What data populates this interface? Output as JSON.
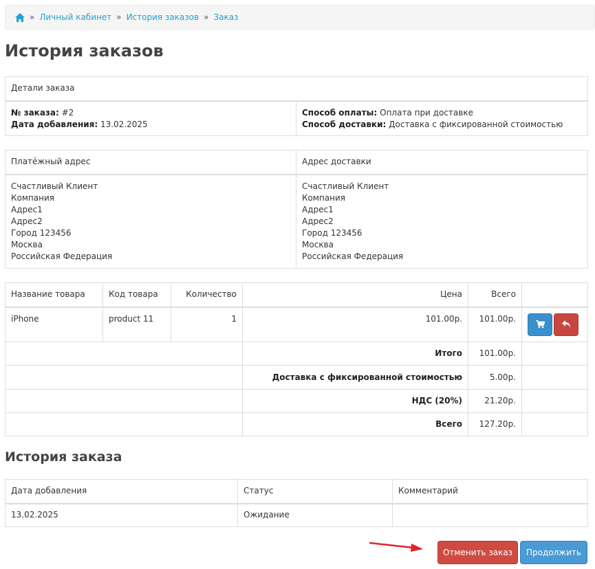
{
  "breadcrumb": {
    "home_icon": "home-icon",
    "items": [
      "Личный кабинет",
      "История заказов",
      "Заказ"
    ],
    "separator": "»"
  },
  "page_title": "История заказов",
  "order_details": {
    "header": "Детали заказа",
    "order_no_label": "№ заказа:",
    "order_no_value": "#2",
    "date_added_label": "Дата добавления:",
    "date_added_value": "13.02.2025",
    "payment_label": "Способ оплаты:",
    "payment_value": "Оплата при доставке",
    "shipping_label": "Способ доставки:",
    "shipping_value": "Доставка с фиксированной стоимостью"
  },
  "addresses": {
    "payment_header": "Платёжный адрес",
    "shipping_header": "Адрес доставки",
    "payment_lines": [
      "Счастливый Клиент",
      "Компания",
      "Адрес1",
      "Адрес2",
      "Город 123456",
      "Москва",
      "Российская Федерация"
    ],
    "shipping_lines": [
      "Счастливый Клиент",
      "Компания",
      "Адрес1",
      "Адрес2",
      "Город 123456",
      "Москва",
      "Российская Федерация"
    ]
  },
  "products": {
    "headers": [
      "Название товара",
      "Код товара",
      "Количество",
      "Цена",
      "Всего"
    ],
    "rows": [
      {
        "name": "iPhone",
        "model": "product 11",
        "quantity": "1",
        "price": "101.00р.",
        "total": "101.00р.",
        "reorder_icon": "cart-icon",
        "return_icon": "reply-icon"
      }
    ],
    "totals": [
      {
        "label": "Итого",
        "value": "101.00р."
      },
      {
        "label": "Доставка с фиксированной стоимостью",
        "value": "5.00р."
      },
      {
        "label": "НДС (20%)",
        "value": "21.20р."
      },
      {
        "label": "Всего",
        "value": "127.20р."
      }
    ]
  },
  "history": {
    "title": "История заказа",
    "headers": [
      "Дата добавления",
      "Статус",
      "Комментарий"
    ],
    "rows": [
      {
        "date": "13.02.2025",
        "status": "Ожидание",
        "comment": ""
      }
    ]
  },
  "buttons": {
    "cancel_label": "Отменить заказ",
    "continue_label": "Продолжить"
  },
  "colors": {
    "link": "#23a1d1",
    "primary": "#4a9bd3",
    "danger": "#cf4b42",
    "annotation_arrow": "#e8202a"
  }
}
